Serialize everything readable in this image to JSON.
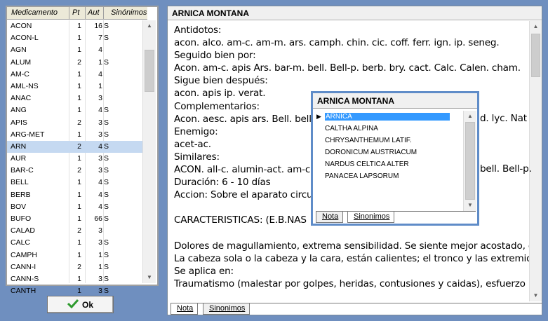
{
  "left_list": {
    "columns": [
      "Medicamento",
      "Pt",
      "Aut",
      "Sinónimos"
    ],
    "selected_index": 10,
    "rows": [
      {
        "name": "ACON",
        "pt": "1",
        "aut": "16",
        "syn": "S"
      },
      {
        "name": "ACON-L",
        "pt": "1",
        "aut": "7",
        "syn": "S"
      },
      {
        "name": "AGN",
        "pt": "1",
        "aut": "4",
        "syn": ""
      },
      {
        "name": "ALUM",
        "pt": "2",
        "aut": "1",
        "syn": "S"
      },
      {
        "name": "AM-C",
        "pt": "1",
        "aut": "4",
        "syn": ""
      },
      {
        "name": "AML-NS",
        "pt": "1",
        "aut": "1",
        "syn": ""
      },
      {
        "name": "ANAC",
        "pt": "1",
        "aut": "3",
        "syn": ""
      },
      {
        "name": "ANG",
        "pt": "1",
        "aut": "4",
        "syn": "S"
      },
      {
        "name": "APIS",
        "pt": "2",
        "aut": "3",
        "syn": "S"
      },
      {
        "name": "ARG-MET",
        "pt": "1",
        "aut": "3",
        "syn": "S"
      },
      {
        "name": "ARN",
        "pt": "2",
        "aut": "4",
        "syn": "S"
      },
      {
        "name": "AUR",
        "pt": "1",
        "aut": "3",
        "syn": "S"
      },
      {
        "name": "BAR-C",
        "pt": "2",
        "aut": "3",
        "syn": "S"
      },
      {
        "name": "BELL",
        "pt": "1",
        "aut": "4",
        "syn": "S"
      },
      {
        "name": "BERB",
        "pt": "1",
        "aut": "4",
        "syn": "S"
      },
      {
        "name": "BOV",
        "pt": "1",
        "aut": "4",
        "syn": "S"
      },
      {
        "name": "BUFO",
        "pt": "1",
        "aut": "66",
        "syn": "S"
      },
      {
        "name": "CALAD",
        "pt": "2",
        "aut": "3",
        "syn": ""
      },
      {
        "name": "CALC",
        "pt": "1",
        "aut": "3",
        "syn": "S"
      },
      {
        "name": "CAMPH",
        "pt": "1",
        "aut": "1",
        "syn": "S"
      },
      {
        "name": "CANN-I",
        "pt": "2",
        "aut": "1",
        "syn": "S"
      },
      {
        "name": "CANN-S",
        "pt": "1",
        "aut": "3",
        "syn": "S"
      },
      {
        "name": "CANTH",
        "pt": "1",
        "aut": "3",
        "syn": "S"
      }
    ]
  },
  "ok_button": {
    "label": "Ok"
  },
  "detail": {
    "title": "ARNICA MONTANA",
    "lines": [
      "Antidotos:",
      "acon. alco. am-c. am-m. ars. camph. chin. cic. coff. ferr. ign. ip. seneg.",
      "Seguido bien por:",
      "Acon. am-c. apis Ars. bar-m. bell. Bell-p. berb. bry. cact. Calc. Calen. cham.",
      "Sigue bien después:",
      "acon. apis ip. verat.",
      "Complementarios:",
      "Acon. aesc. apis ars. Bell. bell-",
      "Enemigo:",
      "acet-ac.",
      "Similares:",
      "ACON. all-c. alumin-act. am-c.",
      "Duración: 6 - 10 días",
      "Accion: Sobre el aparato circul",
      "",
      "CARACTERISTICAS: (E.B.NAS",
      "",
      "Dolores de magullamiento, extrema sensibilidad. Se siente mejor acostado, co",
      "La cabeza sola o la cabeza y la cara, están calientes; el tronco y las extremid",
      "Se aplica en:",
      "Traumatismo (malestar por golpes, heridas, contusiones y caidas), esfuerzo"
    ],
    "occluded_tails": {
      "complementarios": "d. lyc. Nat",
      "similares": "bell. Bell-p."
    },
    "tabs": [
      "Nota",
      "Sinonimos"
    ]
  },
  "popup": {
    "title": "ARNICA MONTANA",
    "selected_index": 0,
    "synonyms": [
      "ARNICA",
      "CALTHA ALPINA",
      "CHRYSANTHEMUM LATIF.",
      "DORONICUM AUSTRIACUM",
      "NARDUS CELTICA ALTER",
      "PANACEA LAPSORUM"
    ],
    "tabs": [
      "Nota",
      "Sinonimos"
    ]
  },
  "colors": {
    "background": "#6f8fbf",
    "row_selected": "#c5d9f1",
    "popup_border": "#5f8cc8",
    "synonym_selected": "#3399ff",
    "ok_check": "#2e9a2e"
  },
  "icons": [
    "checkmark-icon",
    "scroll-up-arrow-icon",
    "scroll-down-arrow-icon",
    "row-pointer-icon"
  ]
}
